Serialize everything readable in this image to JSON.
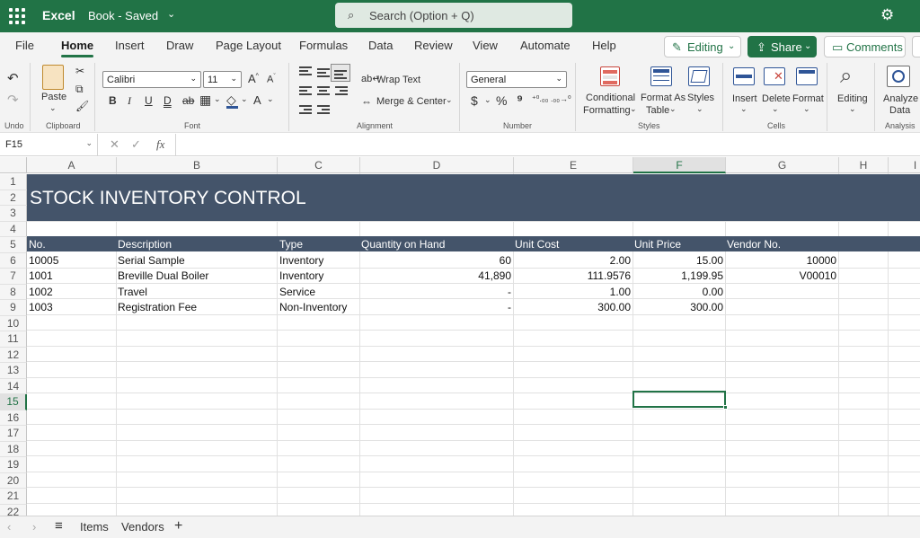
{
  "titlebar": {
    "app_name": "Excel",
    "book_status": "Book - Saved",
    "search_placeholder": "Search (Option + Q)"
  },
  "tabs": [
    "File",
    "Home",
    "Insert",
    "Draw",
    "Page Layout",
    "Formulas",
    "Data",
    "Review",
    "View",
    "Automate",
    "Help"
  ],
  "active_tab": "Home",
  "top_buttons": {
    "editing": "Editing",
    "share": "Share",
    "comments": "Comments"
  },
  "ribbon": {
    "groups": [
      "Undo",
      "Clipboard",
      "Font",
      "Alignment",
      "Number",
      "Styles",
      "Cells",
      "Analysis"
    ],
    "paste": "Paste",
    "font_name": "Calibri",
    "font_size": "11",
    "wrap_text": "Wrap Text",
    "merge_center": "Merge & Center",
    "number_format": "General",
    "conditional_line1": "Conditional",
    "conditional_line2": "Formatting",
    "format_as_line1": "Format As",
    "format_as_line2": "Table",
    "styles": "Styles",
    "insert": "Insert",
    "delete": "Delete",
    "format": "Format",
    "editing": "Editing",
    "analyze_line1": "Analyze",
    "analyze_line2": "Data"
  },
  "formula_bar": {
    "name_box": "F15",
    "fx": "fx"
  },
  "columns": [
    "A",
    "B",
    "C",
    "D",
    "E",
    "F",
    "G",
    "H",
    "I"
  ],
  "selected_column": "F",
  "rows": [
    "1",
    "2",
    "3",
    "4",
    "5",
    "6",
    "7",
    "8",
    "9",
    "10",
    "11",
    "12",
    "13",
    "14",
    "15",
    "16",
    "17",
    "18",
    "19",
    "20",
    "21",
    "22"
  ],
  "selected_row": "15",
  "sheet": {
    "title": "STOCK INVENTORY CONTROL",
    "headers": [
      "No.",
      "Description",
      "Type",
      "Quantity on Hand",
      "Unit Cost",
      "Unit Price",
      "Vendor No."
    ],
    "data": [
      [
        "10005",
        "Serial Sample",
        "Inventory",
        "60",
        "2.00",
        "15.00",
        "10000"
      ],
      [
        "1001",
        "Breville Dual Boiler",
        "Inventory",
        "41,890",
        "111.9576",
        "1,199.95",
        "V00010"
      ],
      [
        "1002",
        "Travel",
        "Service",
        "-",
        "1.00",
        "0.00",
        ""
      ],
      [
        "1003",
        "Registration Fee",
        "Non-Inventory",
        "-",
        "300.00",
        "300.00",
        ""
      ]
    ]
  },
  "sheet_tabs": [
    "Items",
    "Vendors"
  ],
  "colors": {
    "excel_green": "#217346",
    "banner": "#44546a"
  }
}
